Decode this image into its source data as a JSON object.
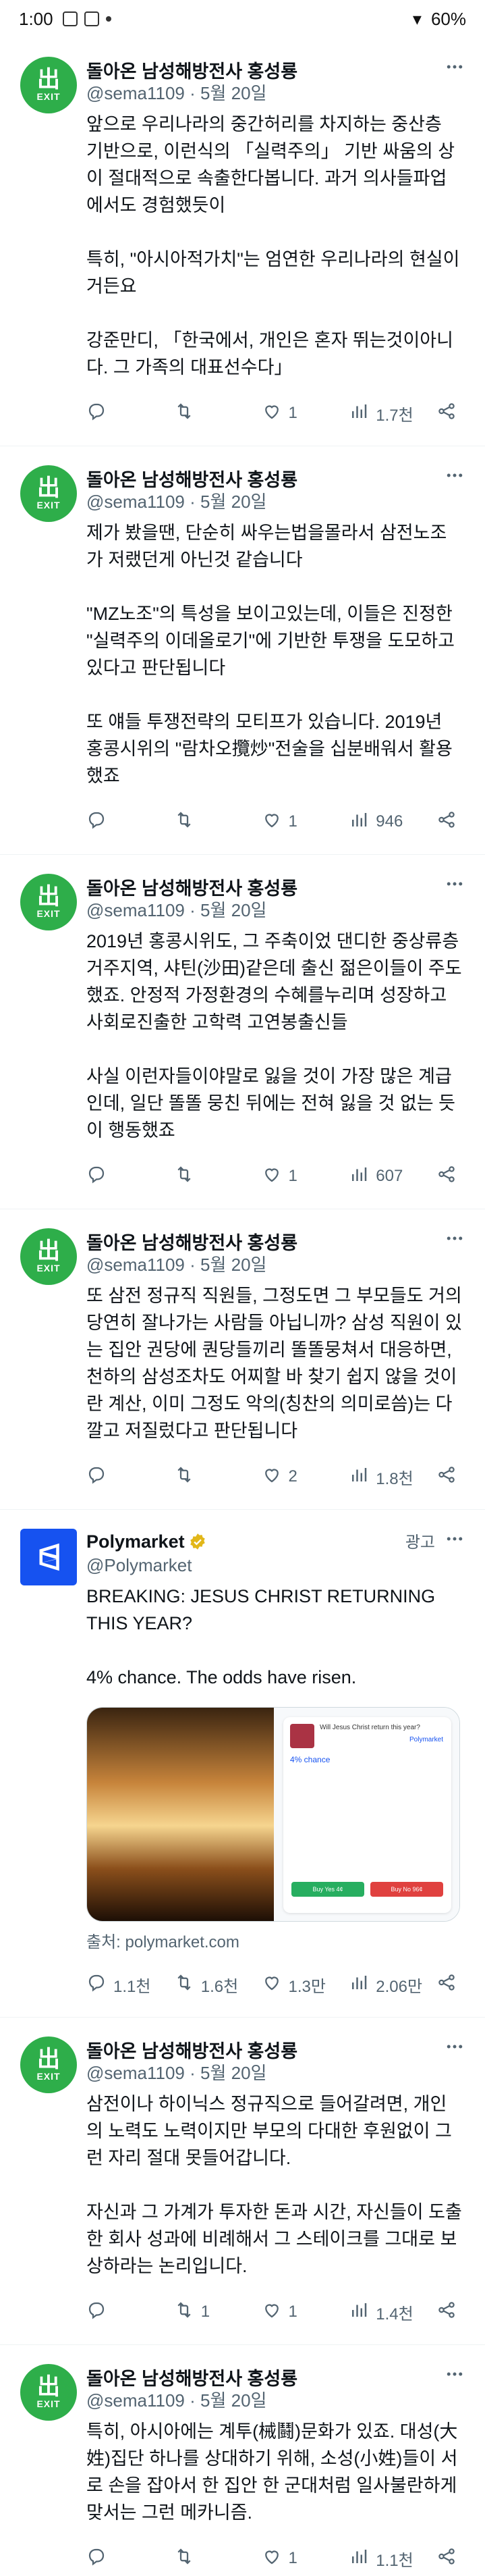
{
  "status_bar": {
    "time": "1:00",
    "battery": "60%"
  },
  "tweets": [
    {
      "name": "돌아온 남성해방전사 홍성룡",
      "handle": "@sema1109",
      "date": "5월 20일",
      "paragraphs": [
        "앞으로 우리나라의 중간허리를 차지하는 중산층 기반으로, 이런식의 「실력주의」 기반 싸움의 상이 절대적으로 속출한다봅니다. 과거 의사들파업에서도 경험했듯이",
        "특히, \"아시아적가치\"는 엄연한 우리나라의 현실이거든요",
        "강준만디, 「한국에서, 개인은 혼자 뛰는것이아니다. 그 가족의 대표선수다」"
      ],
      "actions": {
        "replies": "",
        "retweets": "",
        "likes": "1",
        "views": "1.7천"
      }
    },
    {
      "name": "돌아온 남성해방전사 홍성룡",
      "handle": "@sema1109",
      "date": "5월 20일",
      "paragraphs": [
        "제가 봤을땐, 단순히 싸우는법을몰라서 삼전노조가 저랬던게 아닌것 같습니다",
        "\"MZ노조\"의 특성을 보이고있는데, 이들은 진정한 \"실력주의 이데올로기\"에 기반한 투쟁을 도모하고 있다고 판단됩니다",
        "또 얘들 투쟁전략의 모티프가 있습니다. 2019년 홍콩시위의 \"람차오攬炒\"전술을 십분배워서 활용했죠"
      ],
      "actions": {
        "replies": "",
        "retweets": "",
        "likes": "1",
        "views": "946"
      }
    },
    {
      "name": "돌아온 남성해방전사 홍성룡",
      "handle": "@sema1109",
      "date": "5월 20일",
      "paragraphs": [
        "2019년 홍콩시위도, 그 주축이었 댄디한 중상류층 거주지역, 샤틴(沙田)같은데 출신 젊은이들이 주도했죠. 안정적 가정환경의 수혜를누리며 성장하고 사회로진출한 고학력 고연봉출신들",
        "사실 이런자들이야말로 잃을 것이 가장 많은 계급인데, 일단 똘똘 뭉친 뒤에는 전혀 잃을 것 없는 듯이 행동했죠"
      ],
      "actions": {
        "replies": "",
        "retweets": "",
        "likes": "1",
        "views": "607"
      }
    },
    {
      "name": "돌아온 남성해방전사 홍성룡",
      "handle": "@sema1109",
      "date": "5월 20일",
      "paragraphs": [
        "또 삼전 정규직 직원들, 그정도면 그 부모들도 거의 당연히 잘나가는 사람들 아닙니까? 삼성 직원이 있는 집안 권당에 퀀당들끼리 똘똘뭉쳐서 대응하면, 천하의 삼성조차도 어찌할 바 찾기 쉽지 않을 것이란 계산, 이미 그정도 악의(칭찬의 의미로씀)는 다 깔고 저질렀다고 판단됩니다"
      ],
      "actions": {
        "replies": "",
        "retweets": "",
        "likes": "2",
        "views": "1.8천"
      }
    },
    {
      "name": "Polymarket",
      "handle": "@Polymarket",
      "ad_label": "광고",
      "paragraphs": [
        "BREAKING: JESUS CHRIST RETURNING THIS YEAR?",
        "4% chance. The odds have risen."
      ],
      "media": {
        "card_title": "Will Jesus Christ return this year?",
        "brand": "Polymarket",
        "chance": "4% chance",
        "yes_label": "Buy Yes 4¢",
        "no_label": "Buy No 96¢"
      },
      "source": "출처: polymarket.com",
      "actions": {
        "replies": "1.1천",
        "retweets": "1.6천",
        "likes": "1.3만",
        "views": "2.06만"
      }
    },
    {
      "name": "돌아온 남성해방전사 홍성룡",
      "handle": "@sema1109",
      "date": "5월 20일",
      "paragraphs": [
        "삼전이나 하이닉스 정규직으로 들어갈려면, 개인의 노력도 노력이지만 부모의 다대한 후원없이 그런 자리 절대 못들어갑니다.",
        "자신과 그 가계가 투자한 돈과 시간, 자신들이 도출한 회사 성과에 비례해서 그 스테이크를 그대로 보상하라는 논리입니다."
      ],
      "actions": {
        "replies": "",
        "retweets": "1",
        "likes": "1",
        "views": "1.4천"
      }
    },
    {
      "name": "돌아온 남성해방전사 홍성룡",
      "handle": "@sema1109",
      "date": "5월 20일",
      "paragraphs": [
        "특히, 아시아에는 계투(械鬪)문화가 있죠. 대성(大姓)집단 하나를 상대하기 위해, 소성(小姓)들이 서로 손을 잡아서 한 집안 한 군대처럼 일사불란하게 맞서는 그런 메카니즘."
      ],
      "actions": {
        "replies": "",
        "retweets": "",
        "likes": "1",
        "views": "1.1천"
      }
    }
  ]
}
